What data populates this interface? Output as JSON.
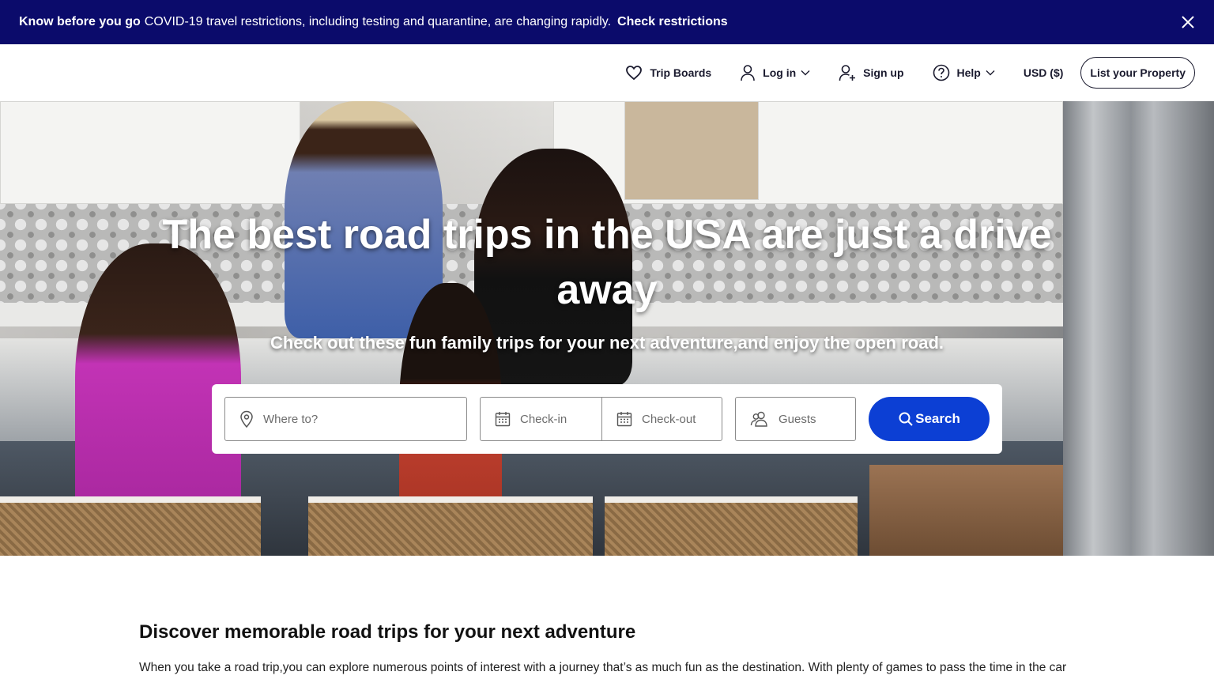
{
  "alert": {
    "heading": "Know before you go",
    "message": "COVID-19 travel restrictions, including testing and quarantine, are changing rapidly.",
    "link": "Check restrictions",
    "close_icon": "close-icon"
  },
  "nav": {
    "trip_boards": "Trip Boards",
    "log_in": "Log in",
    "sign_up": "Sign up",
    "help": "Help",
    "currency": "USD ($)",
    "list_property": "List your Property"
  },
  "hero": {
    "title": "The best road trips in the USA are just a drive away",
    "subtitle": "Check out these fun family trips for your next adventure,and enjoy the open road."
  },
  "search": {
    "where_placeholder": "Where to?",
    "checkin_placeholder": "Check-in",
    "checkout_placeholder": "Check-out",
    "guests_placeholder": "Guests",
    "button": "Search"
  },
  "content": {
    "heading": "Discover memorable road trips for your next adventure",
    "paragraph": "When you take a road trip,you can explore numerous points of interest with a journey that’s as much fun as the destination. With plenty of games to pass the time in the car"
  },
  "colors": {
    "alert_bg": "#0b0b6b",
    "primary": "#0c3fd4",
    "text_dark": "#1a1a2e"
  }
}
